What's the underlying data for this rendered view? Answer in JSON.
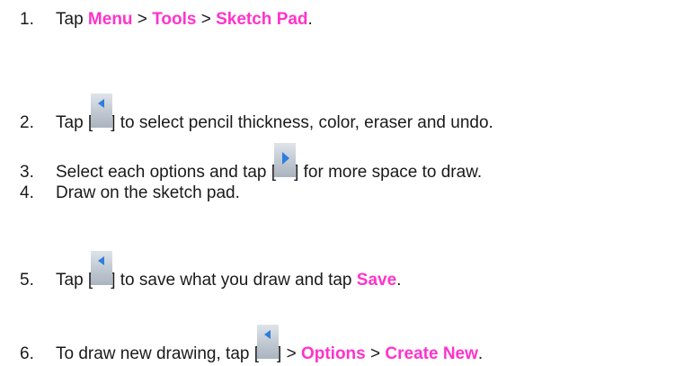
{
  "steps": [
    {
      "number": "1.",
      "parts": [
        "Tap ",
        "Menu",
        " > ",
        "Tools",
        " > ",
        "Sketch Pad",
        "."
      ]
    },
    {
      "number": "2.",
      "before": "Tap [",
      "icon": "back-arrow-icon",
      "after": "] to select pencil thickness, color, eraser and undo."
    },
    {
      "number": "3.",
      "before": "Select each options and tap [",
      "icon": "forward-arrow-icon",
      "after": "] for more space to draw."
    },
    {
      "number": "4.",
      "text": "Draw on the sketch pad."
    },
    {
      "number": "5.",
      "before": "Tap [",
      "icon": "back-arrow-icon",
      "middle": "] to save what you draw and tap ",
      "keyword": "Save",
      "after": "."
    },
    {
      "number": "6.",
      "before": "To draw new drawing, tap [",
      "icon": "back-arrow-icon",
      "middle1": "] > ",
      "keyword1": "Options",
      "middle2": " > ",
      "keyword2": "Create New",
      "after": "."
    }
  ],
  "colors": {
    "keyword": "#ff33cc",
    "text": "#1a1a1a",
    "icon_arrow": "#2e7de0",
    "icon_bg": "#c8d0d8"
  }
}
